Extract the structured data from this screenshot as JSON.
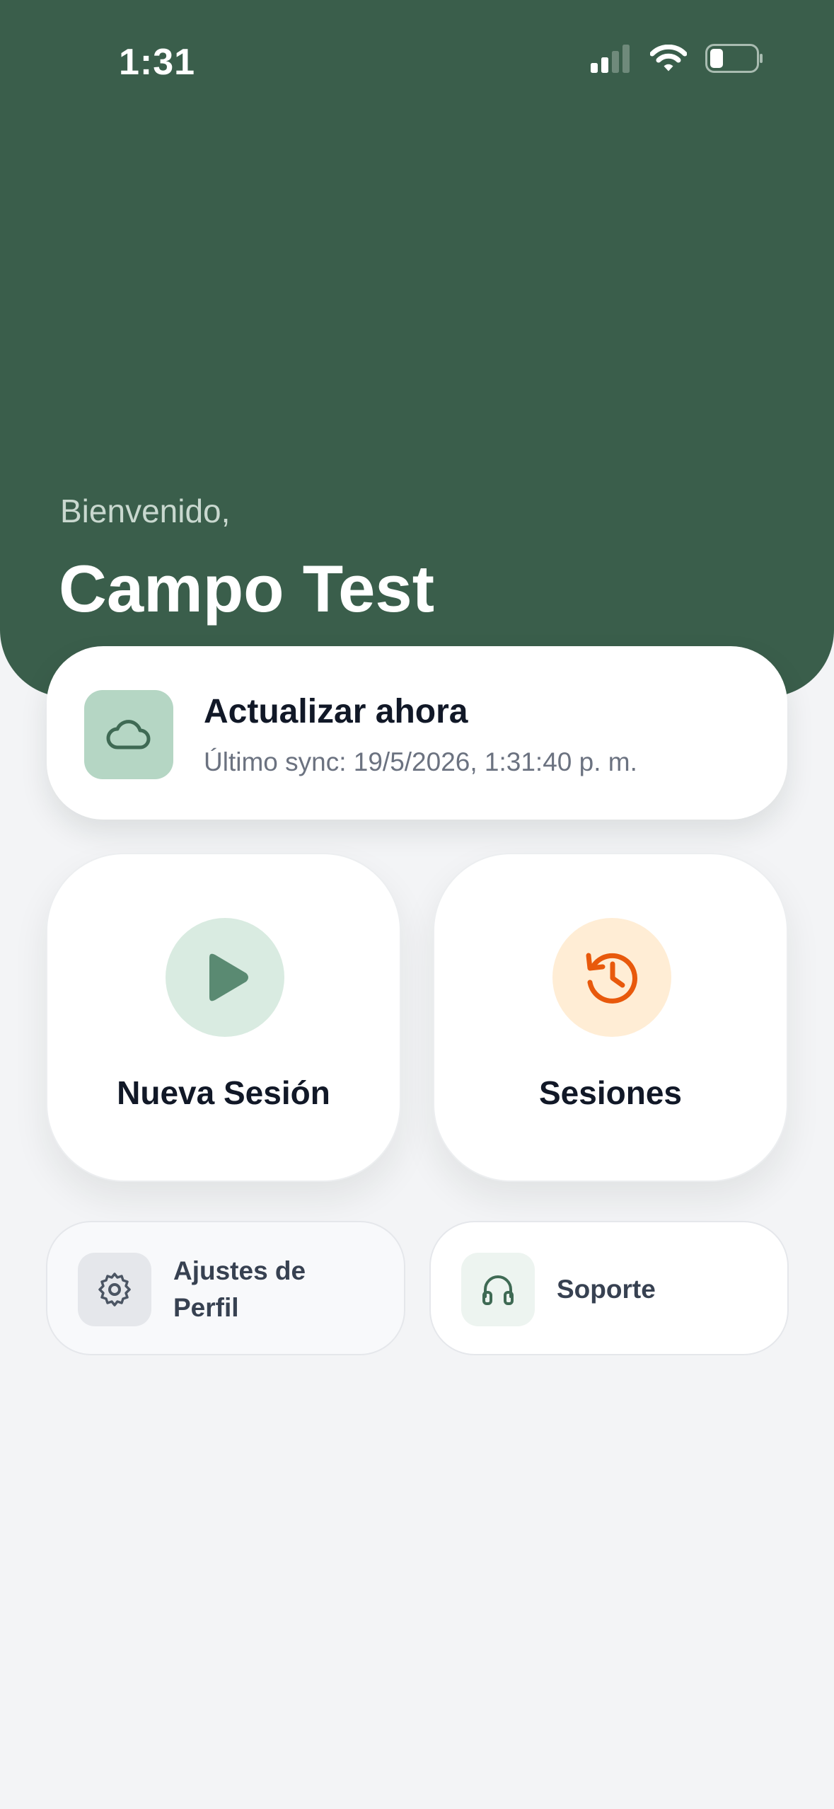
{
  "status_bar": {
    "time": "1:31",
    "icons": [
      "signal-icon",
      "wifi-icon",
      "battery-icon"
    ]
  },
  "header": {
    "greeting": "Bienvenido,",
    "user_name": "Campo Test"
  },
  "sync": {
    "title": "Actualizar ahora",
    "subtitle": "Último sync: 19/5/2026, 1:31:40 p. m.",
    "icon": "cloud-icon"
  },
  "actions": {
    "new_session": {
      "label": "Nueva Sesión",
      "icon": "play-icon"
    },
    "sessions": {
      "label": "Sesiones",
      "icon": "history-icon"
    }
  },
  "secondary": {
    "profile_line1": "Ajustes de",
    "profile_line2": "Perfil",
    "profile_icon": "gear-icon",
    "support": "Soporte",
    "support_icon": "headphones-icon"
  },
  "colors": {
    "header_bg": "#3a5e4b",
    "accent_green": "#5a8a72",
    "accent_orange": "#e8590c",
    "page_bg": "#f3f4f6"
  }
}
